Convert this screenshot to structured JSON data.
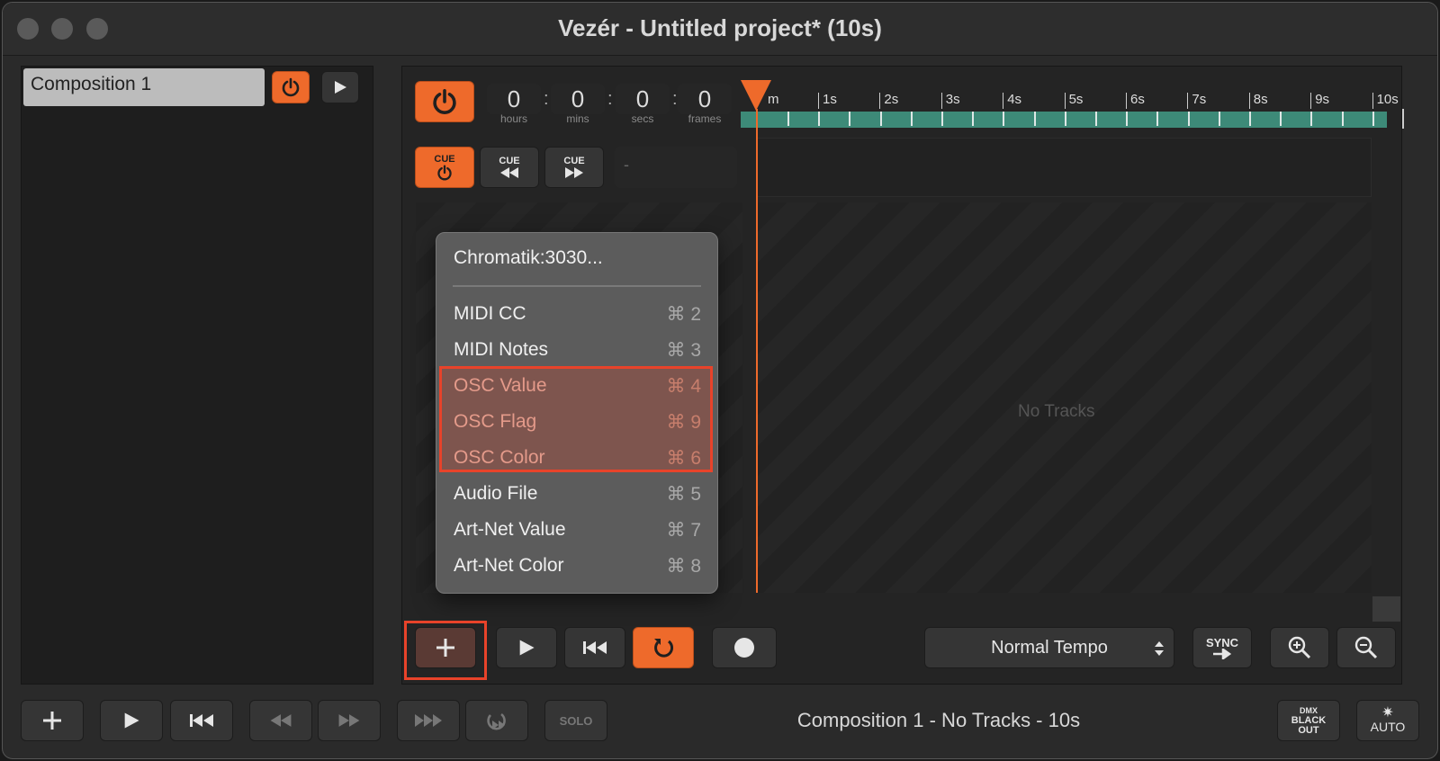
{
  "window": {
    "title": "Vezér - Untitled project* (10s)"
  },
  "composition_list": {
    "items": [
      {
        "label": "Composition 1"
      }
    ]
  },
  "timecode": {
    "hours": "0",
    "mins": "0",
    "secs": "0",
    "frames": "0",
    "labels": {
      "hours": "hours",
      "mins": "mins",
      "secs": "secs",
      "frames": "frames"
    },
    "separator": ":"
  },
  "ruler": {
    "labels": [
      "m",
      "1s",
      "2s",
      "3s",
      "4s",
      "5s",
      "6s",
      "7s",
      "8s",
      "9s",
      "10s"
    ]
  },
  "cue": {
    "label": "CUE",
    "name_field": "-"
  },
  "tracks": {
    "empty_text": "No Tracks"
  },
  "add_track_menu": {
    "header": "Chromatik:3030...",
    "items": [
      {
        "label": "MIDI CC",
        "shortcut": "⌘ 2",
        "highlighted": false
      },
      {
        "label": "MIDI Notes",
        "shortcut": "⌘ 3",
        "highlighted": false
      },
      {
        "label": "OSC Value",
        "shortcut": "⌘ 4",
        "highlighted": true
      },
      {
        "label": "OSC Flag",
        "shortcut": "⌘ 9",
        "highlighted": true
      },
      {
        "label": "OSC Color",
        "shortcut": "⌘ 6",
        "highlighted": true
      },
      {
        "label": "Audio File",
        "shortcut": "⌘ 5",
        "highlighted": false
      },
      {
        "label": "Art-Net Value",
        "shortcut": "⌘ 7",
        "highlighted": false
      },
      {
        "label": "Art-Net Color",
        "shortcut": "⌘ 8",
        "highlighted": false
      }
    ]
  },
  "transport": {
    "tempo": "Normal Tempo",
    "sync_label": "SYNC"
  },
  "bottom_bar": {
    "status": "Composition 1 - No Tracks - 10s",
    "solo_label": "SOLO",
    "dmx_label_1": "DMX",
    "dmx_label_2": "BLACK",
    "dmx_label_3": "OUT",
    "auto_label": "AUTO"
  },
  "colors": {
    "accent": "#ee6a2b",
    "highlight_border": "#e8432a",
    "track_bar": "#3d8a78",
    "playhead": "#ee6a2b"
  }
}
